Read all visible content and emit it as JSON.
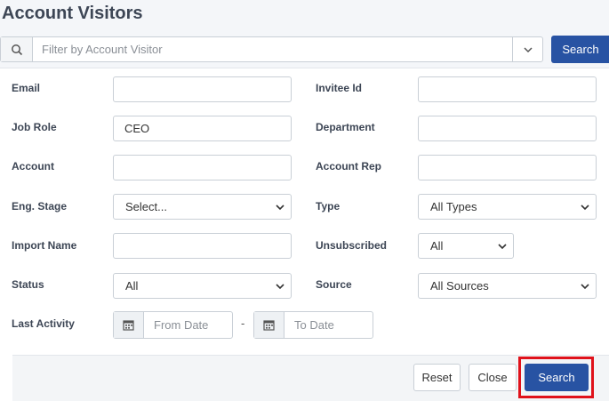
{
  "title": "Account Visitors",
  "filter": {
    "placeholder": "Filter by Account Visitor",
    "search_label": "Search"
  },
  "left_fields": {
    "email": {
      "label": "Email",
      "value": ""
    },
    "job_role": {
      "label": "Job Role",
      "value": "CEO"
    },
    "account": {
      "label": "Account",
      "value": ""
    },
    "eng_stage": {
      "label": "Eng. Stage",
      "value": "Select..."
    },
    "import_name": {
      "label": "Import Name",
      "value": ""
    },
    "status": {
      "label": "Status",
      "value": "All"
    },
    "last_activity": {
      "label": "Last Activity",
      "from_placeholder": "From Date",
      "to_placeholder": "To Date",
      "separator": "-"
    }
  },
  "right_fields": {
    "invitee_id": {
      "label": "Invitee Id",
      "value": ""
    },
    "department": {
      "label": "Department",
      "value": ""
    },
    "account_rep": {
      "label": "Account Rep",
      "value": ""
    },
    "type": {
      "label": "Type",
      "value": "All Types"
    },
    "unsubscribed": {
      "label": "Unsubscribed",
      "value": "All"
    },
    "source": {
      "label": "Source",
      "value": "All Sources"
    }
  },
  "footer": {
    "reset_label": "Reset",
    "close_label": "Close",
    "search_label": "Search"
  },
  "colors": {
    "primary": "#2853a3",
    "highlight": "#e0121b"
  },
  "icons": {
    "search": "search-icon",
    "chevron": "chevron-down-icon",
    "calendar": "calendar-icon"
  }
}
